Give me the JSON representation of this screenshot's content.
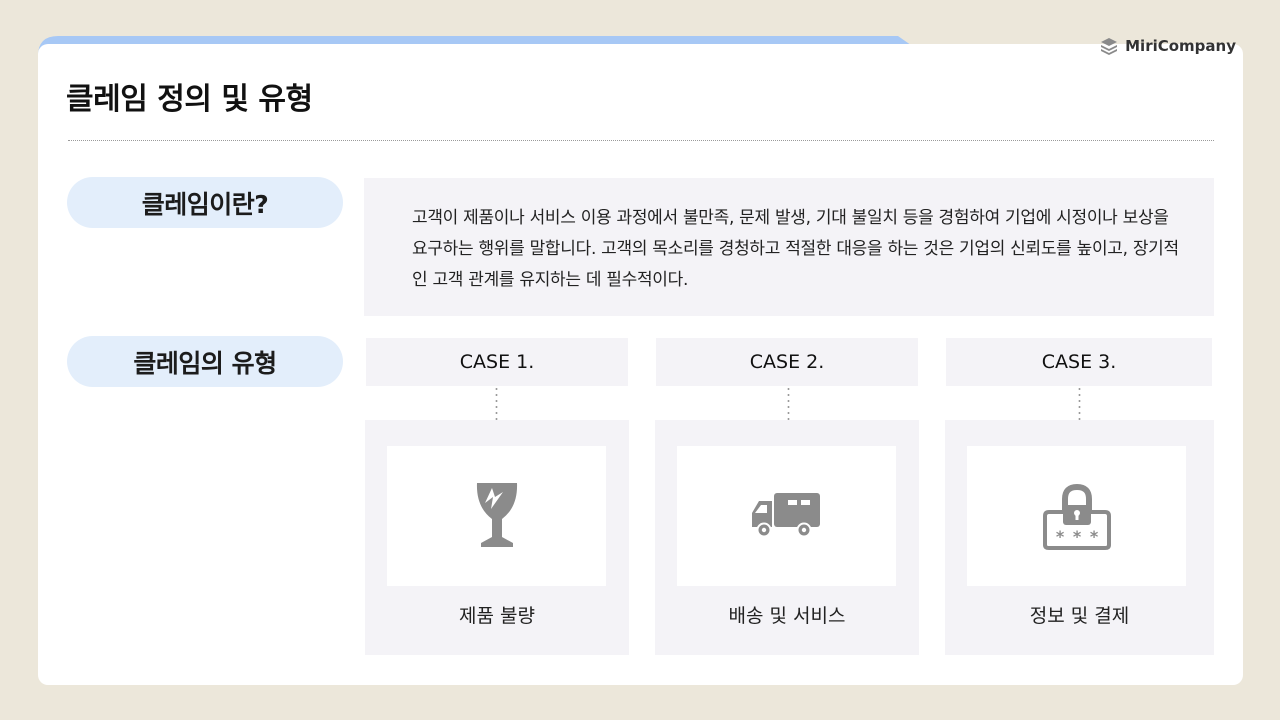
{
  "brand": {
    "name": "MiriCompany",
    "icon": "stack-icon"
  },
  "page_title": "클레임 정의 및 유형",
  "definition": {
    "label": "클레임이란?",
    "text": "고객이 제품이나 서비스 이용 과정에서 불만족, 문제 발생, 기대 불일치 등을 경험하여 기업에 시정이나 보상을 요구하는 행위를 말합니다. 고객의 목소리를 경청하고 적절한 대응을 하는 것은 기업의 신뢰도를 높이고, 장기적인 고객 관계를 유지하는 데 필수적이다."
  },
  "types": {
    "label": "클레임의 유형",
    "cases": [
      {
        "heading": "CASE 1.",
        "label": "제품 불량",
        "icon": "broken-glass-icon"
      },
      {
        "heading": "CASE 2.",
        "label": "배송 및 서비스",
        "icon": "delivery-truck-icon"
      },
      {
        "heading": "CASE 3.",
        "label": "정보 및 결제",
        "icon": "password-lock-icon"
      }
    ]
  },
  "colors": {
    "accent": "#a7c8f5",
    "pill": "#e3eefb",
    "panel": "#f4f3f7",
    "icon": "#8b8b8b",
    "background": "#ece7da"
  }
}
